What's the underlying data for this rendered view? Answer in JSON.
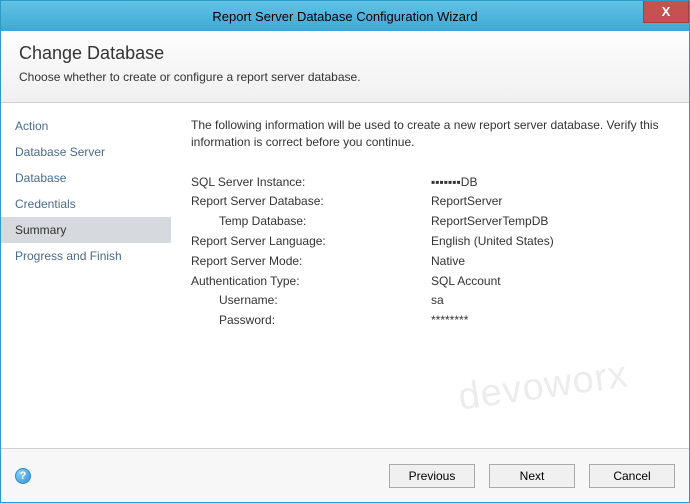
{
  "window": {
    "title": "Report Server Database Configuration Wizard",
    "close_label": "X"
  },
  "header": {
    "title": "Change Database",
    "subtitle": "Choose whether to create or configure a report server database."
  },
  "sidebar": {
    "steps": [
      {
        "label": "Action",
        "selected": false
      },
      {
        "label": "Database Server",
        "selected": false
      },
      {
        "label": "Database",
        "selected": false
      },
      {
        "label": "Credentials",
        "selected": false
      },
      {
        "label": "Summary",
        "selected": true
      },
      {
        "label": "Progress and Finish",
        "selected": false
      }
    ]
  },
  "content": {
    "intro": "The following information will be used to create a new report server database. Verify this information is correct before you continue.",
    "rows": [
      {
        "label": "SQL Server Instance:",
        "value": "▪▪▪▪▪▪▪DB",
        "indent": false
      },
      {
        "label": "Report Server Database:",
        "value": "ReportServer",
        "indent": false
      },
      {
        "label": "Temp Database:",
        "value": "ReportServerTempDB",
        "indent": true
      },
      {
        "label": "Report Server Language:",
        "value": "English (United States)",
        "indent": false
      },
      {
        "label": "Report Server Mode:",
        "value": "Native",
        "indent": false
      },
      {
        "label": "Authentication Type:",
        "value": "SQL Account",
        "indent": false
      },
      {
        "label": "Username:",
        "value": "sa",
        "indent": true
      },
      {
        "label": "Password:",
        "value": "********",
        "indent": true
      }
    ]
  },
  "footer": {
    "help_tooltip": "Help",
    "previous": "Previous",
    "next": "Next",
    "cancel": "Cancel"
  },
  "watermark": "devoworx"
}
